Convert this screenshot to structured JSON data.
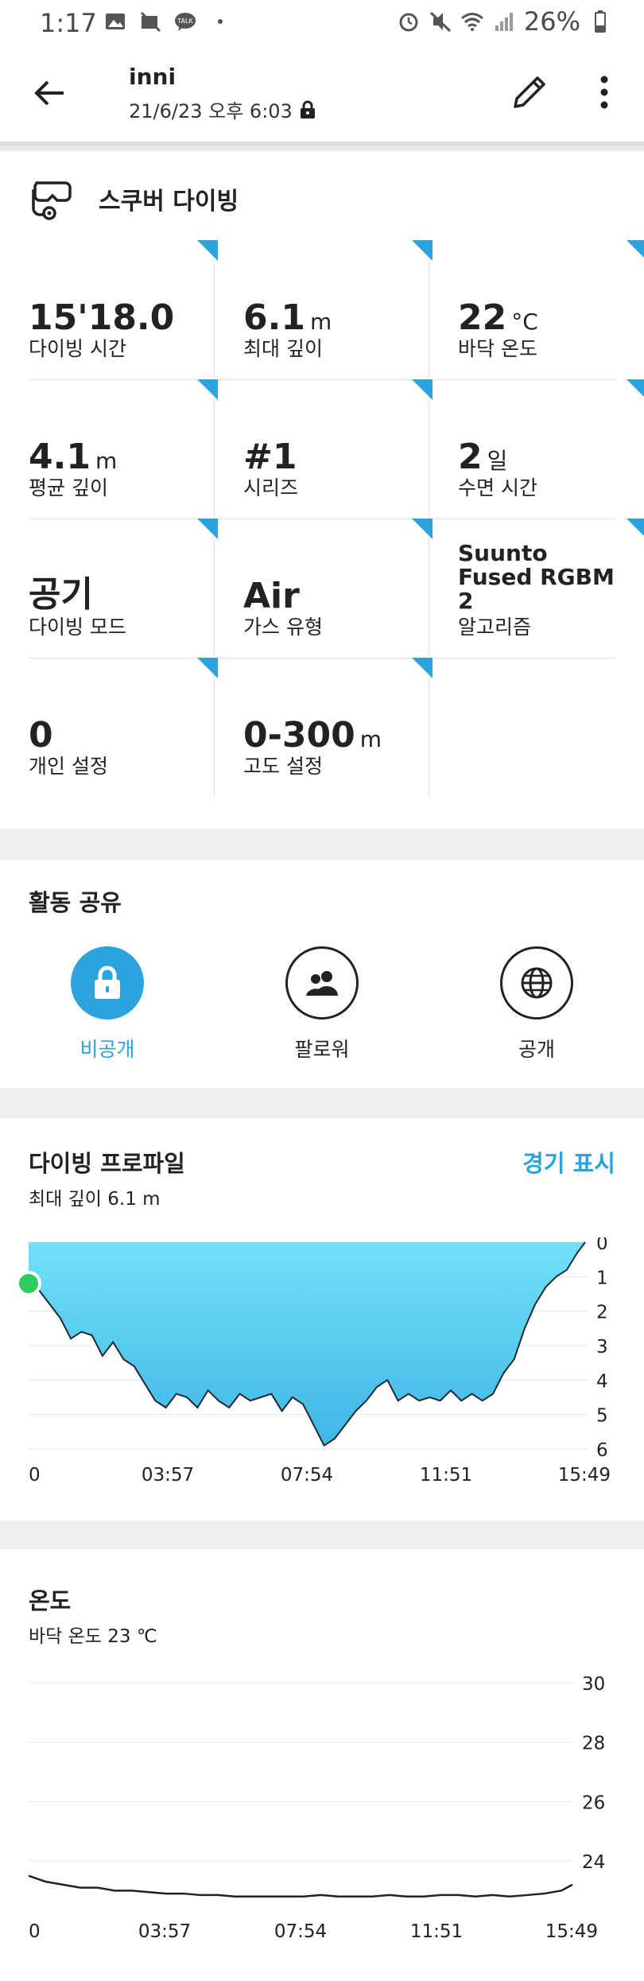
{
  "status_bar": {
    "time": "1:17",
    "left_icons": [
      "gallery-icon",
      "mute-notification-icon",
      "kakaotalk-icon",
      "dot-icon"
    ],
    "right_icons": [
      "alarm-icon",
      "vibrate-mute-icon",
      "wifi-icon",
      "signal-icon",
      "battery-icon"
    ],
    "battery": "26%"
  },
  "header": {
    "title": "inni",
    "subtitle": "21/6/23 오후 6:03"
  },
  "dive": {
    "type_label": "스쿠버 다이빙",
    "stats": [
      {
        "value": "15'18.0",
        "unit": "",
        "label": "다이빙 시간"
      },
      {
        "value": "6.1",
        "unit": "m",
        "label": "최대 깊이"
      },
      {
        "value": "22",
        "unit": "°C",
        "label": "바닥 온도"
      },
      {
        "value": "4.1",
        "unit": "m",
        "label": "평균 깊이"
      },
      {
        "value": "#1",
        "unit": "",
        "label": "시리즈"
      },
      {
        "value": "2",
        "unit": "일",
        "label": "수면 시간"
      },
      {
        "value": "공기",
        "unit": "",
        "label": "다이빙 모드"
      },
      {
        "value": "Air",
        "unit": "",
        "label": "가스 유형"
      },
      {
        "value": "Suunto Fused RGBM 2",
        "unit": "",
        "label": "알고리즘"
      },
      {
        "value": "0",
        "unit": "",
        "label": "개인 설정"
      },
      {
        "value": "0-300",
        "unit": "m",
        "label": "고도 설정"
      }
    ]
  },
  "share": {
    "title": "활동 공유",
    "options": [
      {
        "label": "비공개",
        "icon": "lock-icon",
        "selected": true
      },
      {
        "label": "팔로워",
        "icon": "followers-icon",
        "selected": false
      },
      {
        "label": "공개",
        "icon": "globe-icon",
        "selected": false
      }
    ],
    "accent": "#2ba4dd"
  },
  "profile": {
    "title": "다이빙 프로파일",
    "subtitle": "최대 깊이 6.1 m",
    "link": "경기 표시"
  },
  "temperature": {
    "title": "온도",
    "subtitle": "바닥 온도 23 ℃"
  },
  "chart_data": [
    {
      "type": "area",
      "x_ticks": [
        "0",
        "03:57",
        "07:54",
        "11:51",
        "15:49"
      ],
      "y_ticks": [
        "0",
        "1",
        "2",
        "3",
        "4",
        "5",
        "6"
      ],
      "ylim": [
        0,
        6
      ],
      "y_inverted": true,
      "x_minutes": [
        0,
        0.3,
        0.6,
        0.9,
        1.2,
        1.5,
        1.8,
        2.1,
        2.4,
        2.7,
        3.0,
        3.3,
        3.6,
        3.9,
        4.2,
        4.5,
        4.8,
        5.1,
        5.4,
        5.7,
        6.0,
        6.3,
        6.6,
        6.9,
        7.2,
        7.5,
        7.8,
        8.1,
        8.4,
        8.7,
        9.0,
        9.3,
        9.6,
        9.9,
        10.2,
        10.5,
        10.8,
        11.1,
        11.4,
        11.7,
        12.0,
        12.3,
        12.6,
        12.9,
        13.2,
        13.5,
        13.8,
        14.1,
        14.4,
        14.7,
        15.0,
        15.3,
        15.6,
        15.82
      ],
      "depth": [
        1.2,
        1.4,
        1.8,
        2.2,
        2.8,
        2.6,
        2.7,
        3.3,
        2.9,
        3.4,
        3.6,
        4.1,
        4.6,
        4.8,
        4.4,
        4.5,
        4.8,
        4.3,
        4.6,
        4.8,
        4.4,
        4.6,
        4.5,
        4.4,
        4.9,
        4.5,
        4.7,
        5.3,
        5.9,
        5.7,
        5.3,
        4.9,
        4.6,
        4.2,
        4.0,
        4.6,
        4.4,
        4.6,
        4.5,
        4.6,
        4.3,
        4.6,
        4.4,
        4.6,
        4.4,
        3.8,
        3.4,
        2.5,
        1.8,
        1.3,
        1.0,
        0.8,
        0.3,
        0.0
      ],
      "marker_depth": 1.2,
      "fill_color": "#5cd0f0"
    },
    {
      "type": "line",
      "x_ticks": [
        "0",
        "03:57",
        "07:54",
        "11:51",
        "15:49"
      ],
      "y_ticks": [
        "30",
        "28",
        "26",
        "24"
      ],
      "ylim": [
        22.5,
        30
      ],
      "x_minutes": [
        0,
        0.5,
        1.0,
        1.5,
        2.0,
        2.5,
        3.0,
        3.5,
        4.0,
        4.5,
        5.0,
        5.5,
        6.0,
        6.5,
        7.0,
        7.5,
        8.0,
        8.5,
        9.0,
        9.5,
        10.0,
        10.5,
        11.0,
        11.5,
        12.0,
        12.5,
        13.0,
        13.5,
        14.0,
        14.5,
        15.0,
        15.5,
        15.82
      ],
      "temp": [
        23.5,
        23.3,
        23.2,
        23.1,
        23.1,
        23.0,
        23.0,
        22.95,
        22.9,
        22.9,
        22.85,
        22.85,
        22.8,
        22.8,
        22.8,
        22.8,
        22.8,
        22.85,
        22.8,
        22.8,
        22.8,
        22.85,
        22.8,
        22.8,
        22.85,
        22.85,
        22.8,
        22.85,
        22.8,
        22.85,
        22.9,
        23.0,
        23.2
      ]
    }
  ]
}
